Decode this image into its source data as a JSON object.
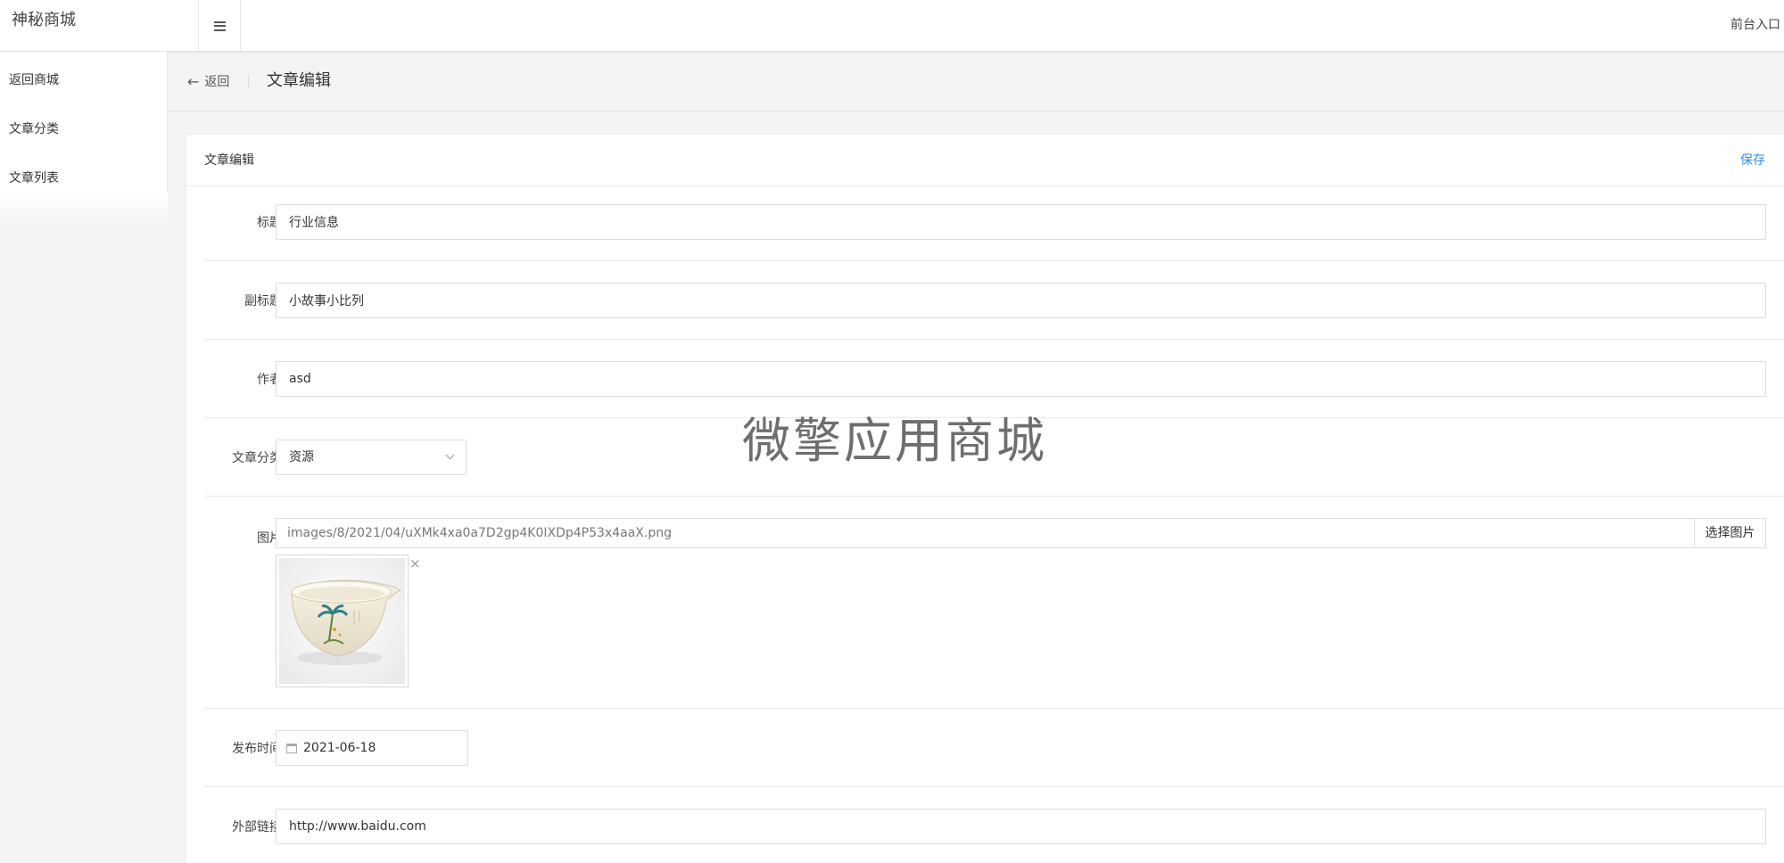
{
  "app": {
    "brand": "神秘商城",
    "front_link": "前台入口"
  },
  "sidebar": {
    "items": [
      {
        "label": "返回商城"
      },
      {
        "label": "文章分类"
      },
      {
        "label": "文章列表"
      }
    ]
  },
  "page": {
    "back_label": "返回",
    "title": "文章编辑"
  },
  "card": {
    "title": "文章编辑",
    "save_label": "保存"
  },
  "form": {
    "title": {
      "label": "标题",
      "value": "行业信息"
    },
    "subtitle": {
      "label": "副标题",
      "value": "小故事小比列"
    },
    "author": {
      "label": "作者",
      "value": "asd"
    },
    "category": {
      "label": "文章分类",
      "value": "资源"
    },
    "image": {
      "label": "图片",
      "path": "images/8/2021/04/uXMk4xa0a7D2gp4K0IXDp4P53x4aaX.png",
      "button": "选择图片",
      "close": "×"
    },
    "publish_time": {
      "label": "发布时间",
      "value": "2021-06-18"
    },
    "external_link": {
      "label": "外部链接",
      "value": "http://www.baidu.com"
    }
  },
  "watermark": "微擎应用商城",
  "icons": {
    "menu": "hamburger-icon",
    "back": "arrow-left-icon",
    "select": "chevron-down-icon",
    "calendar": "calendar-icon",
    "close": "close-icon"
  },
  "colors": {
    "accent": "#2d8cf0",
    "background": "#f4f4f4"
  }
}
